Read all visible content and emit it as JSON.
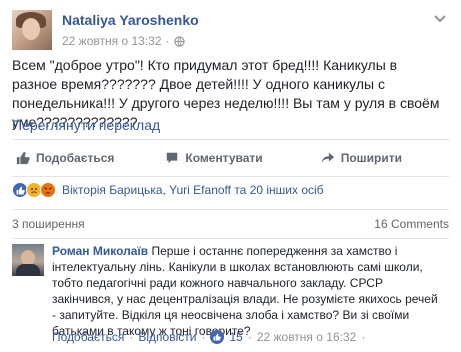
{
  "post": {
    "author": "Nataliya Yaroshenko",
    "date": "22 жовтня о 13:32",
    "text": "Всем \"доброе утро\"! Кто придумал этот бред!!!! Каникулы в разное время??????? Двое детей!!!! У одного каникулы с понедельника!!! У другого через неделю!!!! Вы там у руля в своём уме?????????????",
    "translate": "Переглянути переклад"
  },
  "actions": {
    "like": "Подобається",
    "comment": "Коментувати",
    "share": "Поширити"
  },
  "reactions": {
    "names": "Вікторія Барицька, Yuri Efanoff та 20 інших осіб",
    "icons": [
      "like-icon",
      "sad-icon",
      "angry-icon"
    ]
  },
  "counts": {
    "shares": "3 поширення",
    "comments": "16 Comments"
  },
  "comment": {
    "author": "Роман Миколаїв",
    "text": "Перше і останнє попередження за хамство і інтелектуальну лінь. Канікули в школах встановлюють самі школи, тобто педагогічні ради кожного навчального закладу. СРСР закінчився, у нас децентралізація влади. Не розумієте якихось речей - запитуйте. Відкіля ця неосвічена злоба і хамство? Ви зі своїми батьками в такому ж тоні говорите?",
    "like_label": "Подобається",
    "reply_label": "Відповісти",
    "likes": "15",
    "date": "22 жовтня о 16:32",
    "separator": "·"
  },
  "colors": {
    "link": "#365899",
    "muted": "#90949c",
    "like_blue": "#4267b2"
  }
}
